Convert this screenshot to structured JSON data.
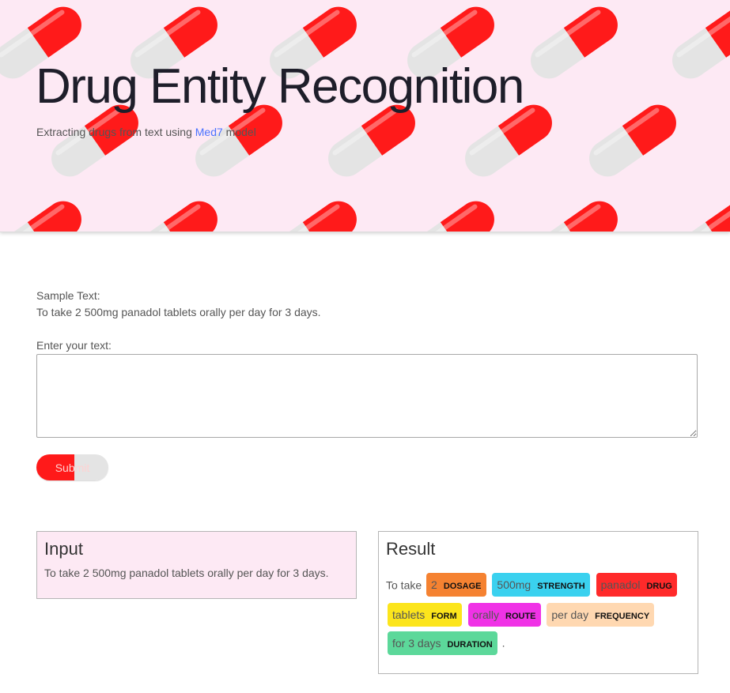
{
  "header": {
    "title": "Drug Entity Recognition",
    "subtitle_before": "Extracting drugs from text using ",
    "subtitle_link": "Med7",
    "subtitle_after": " model"
  },
  "form": {
    "sample_label": "Sample Text:",
    "sample_text": "To take 2 500mg panadol tablets orally per day for 3 days.",
    "enter_label": "Enter your text:",
    "text_value": "",
    "submit_label": "Submit"
  },
  "input_panel": {
    "title": "Input",
    "text": "To take 2 500mg panadol tablets orally per day for 3 days."
  },
  "result_panel": {
    "title": "Result",
    "lead_text": "To take",
    "entities": [
      {
        "text": "2",
        "label": "DOSAGE",
        "color": "#f58231"
      },
      {
        "text": "500mg",
        "label": "STRENGTH",
        "color": "#3ad1ef"
      },
      {
        "text": "panadol",
        "label": "DRUG",
        "color": "#ff2a2a"
      },
      {
        "text": "tablets",
        "label": "FORM",
        "color": "#fce51c"
      },
      {
        "text": "orally",
        "label": "ROUTE",
        "color": "#f032e6"
      },
      {
        "text": "per day",
        "label": "FREQUENCY",
        "color": "#ffd8b1"
      },
      {
        "text": "for 3 days",
        "label": "DURATION",
        "color": "#5cd89a"
      }
    ],
    "trail_text": "."
  },
  "colors": {
    "hero_background": "#fde9f4",
    "capsule_red": "#ff1a1a",
    "capsule_white": "#e4e4e4",
    "link": "#4a73ff"
  }
}
